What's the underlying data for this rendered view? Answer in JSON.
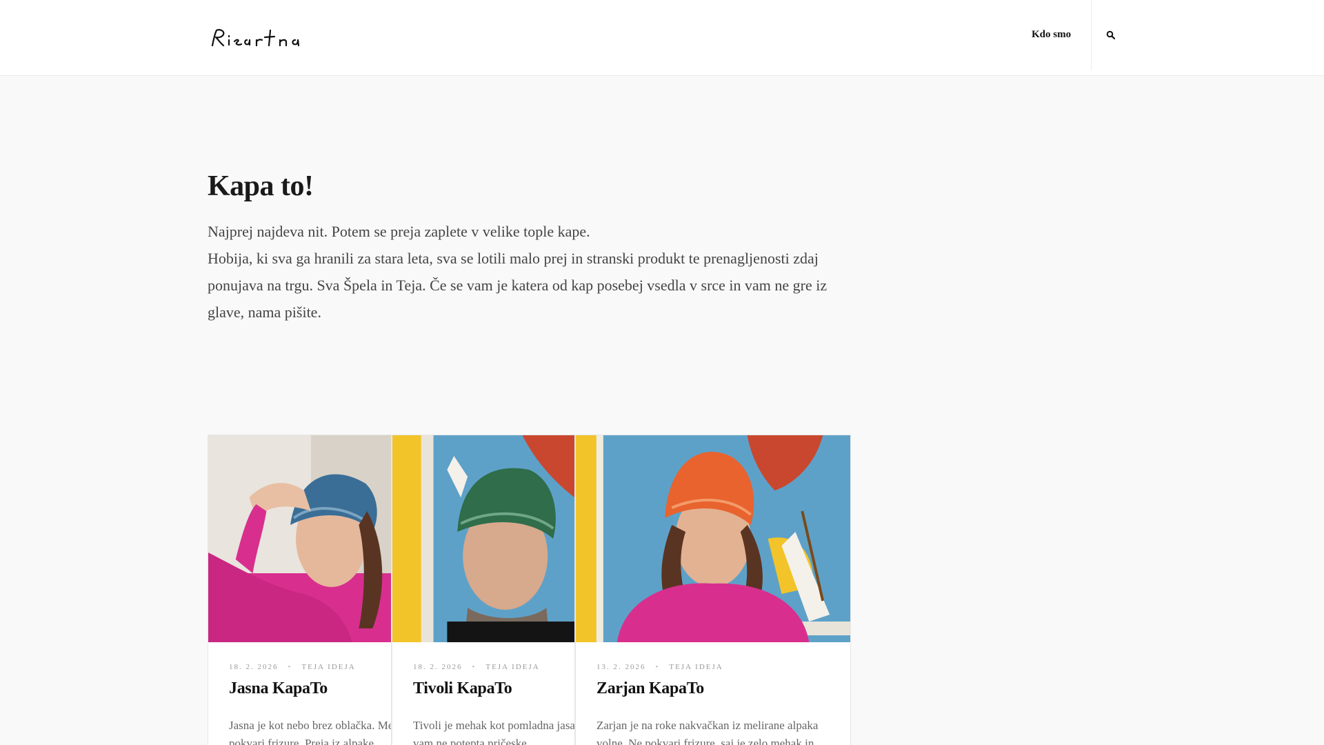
{
  "header": {
    "logo_text": "Risarna",
    "nav": {
      "about_label": "Kdo smo"
    }
  },
  "intro": {
    "title": "Kapa to!",
    "paragraph_1": "Najprej najdeva nit. Potem se preja zaplete v velike tople kape.",
    "paragraph_2": "Hobija, ki sva ga hranili za stara leta, sva se lotili malo prej in stranski produkt te prenagljenosti zdaj ponujava na trgu. Sva Špela in Teja. Če se vam je katera od kap posebej vsedla v srce in vam ne gre iz glave, nama pišite."
  },
  "posts": [
    {
      "date": "18. 2. 2026",
      "category": "TEJA IDEJA",
      "title": "Jasna KapaTo",
      "excerpt": "Jasna je kot nebo brez oblačka. Mehka je in ne pokvari frizure. Preja iz alpake."
    },
    {
      "date": "18. 2. 2026",
      "category": "TEJA IDEJA",
      "title": "Tivoli KapaTo",
      "excerpt": "Tivoli je mehak kot pomladna jasa in je lahka in vam ne potepta pričeske."
    },
    {
      "date": "13. 2. 2026",
      "category": "TEJA IDEJA",
      "title": "Zarjan KapaTo",
      "excerpt": "Zarjan je na roke nakvačkan iz melirane alpaka volne. Ne pokvari frizure, saj je zelo mehak in"
    }
  ],
  "colors": {
    "accent_pink": "#d82f8e",
    "hat_blue": "#3a6e96",
    "hat_green": "#2f6d4b",
    "hat_orange": "#e8632e",
    "poster_blue": "#5ea1c8"
  }
}
